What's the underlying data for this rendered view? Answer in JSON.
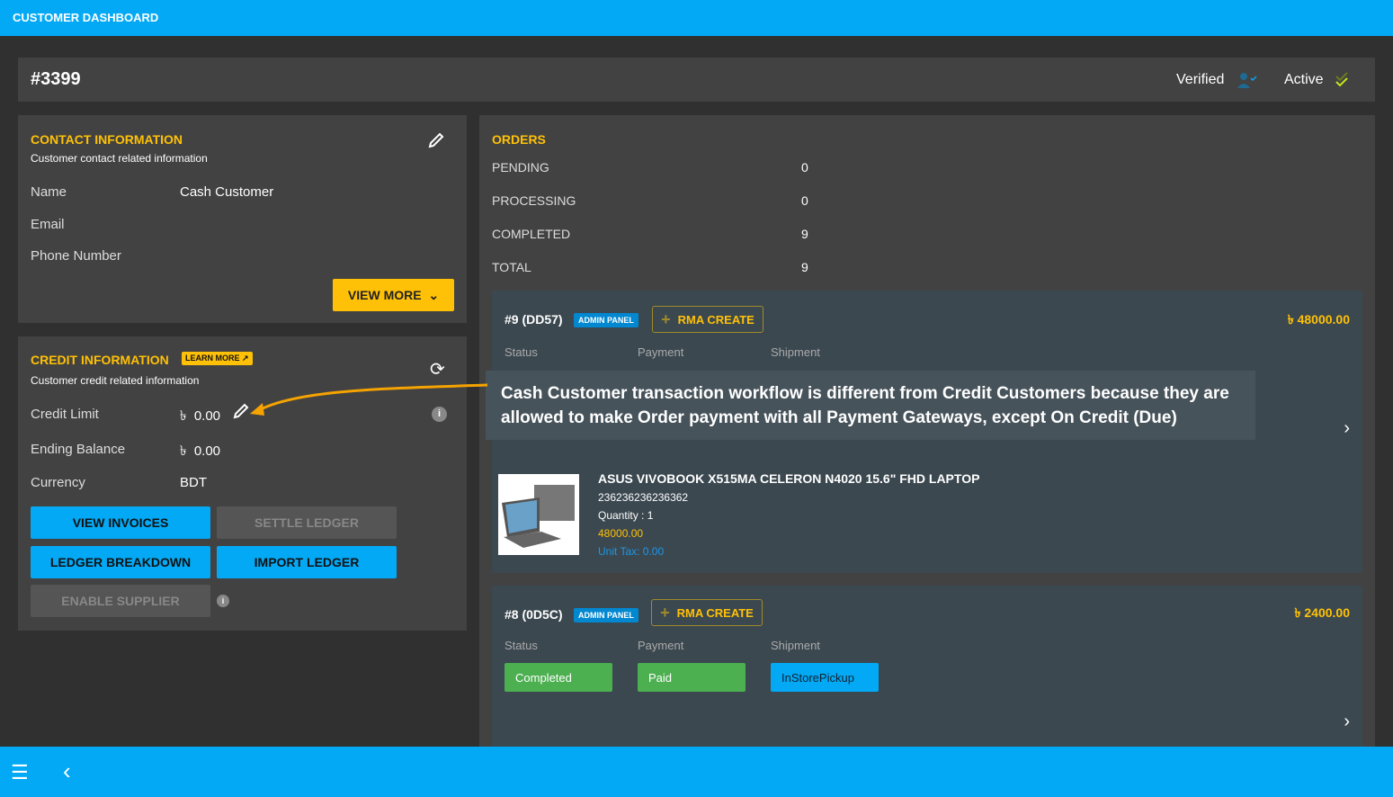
{
  "app_title": "CUSTOMER DASHBOARD",
  "customer": {
    "id": "#3399",
    "verified_label": "Verified",
    "active_label": "Active"
  },
  "contact": {
    "title": "CONTACT INFORMATION",
    "subtitle": "Customer contact related information",
    "fields": [
      {
        "label": "Name",
        "value": "Cash Customer"
      },
      {
        "label": "Email",
        "value": ""
      },
      {
        "label": "Phone Number",
        "value": ""
      }
    ],
    "view_more": "VIEW MORE"
  },
  "credit": {
    "title": "CREDIT INFORMATION",
    "learn_more": "LEARN MORE",
    "subtitle": "Customer credit related information",
    "currency_symbol": "৳",
    "fields": [
      {
        "label": "Credit Limit",
        "value": "0.00"
      },
      {
        "label": "Ending Balance",
        "value": "0.00"
      },
      {
        "label": "Currency",
        "value": "BDT"
      }
    ],
    "buttons": {
      "view_invoices": "VIEW INVOICES",
      "settle_ledger": "SETTLE LEDGER",
      "ledger_breakdown": "LEDGER BREAKDOWN",
      "import_ledger": "IMPORT LEDGER",
      "enable_supplier": "ENABLE SUPPLIER"
    }
  },
  "orders": {
    "title": "ORDERS",
    "summary": [
      {
        "label": "PENDING",
        "value": "0"
      },
      {
        "label": "PROCESSING",
        "value": "0"
      },
      {
        "label": "COMPLETED",
        "value": "9"
      },
      {
        "label": "TOTAL",
        "value": "9"
      }
    ],
    "col_labels": {
      "status": "Status",
      "payment": "Payment",
      "shipment": "Shipment"
    },
    "list": [
      {
        "id": "#9 (DD57)",
        "badge": "ADMIN PANEL",
        "rma": "RMA CREATE",
        "amount": "৳  48000.00",
        "item": {
          "name": "ASUS VIVOBOOK X515MA CELERON N4020 15.6\" FHD LAPTOP",
          "sku": "236236236236362",
          "quantity": "Quantity : 1",
          "price": "48000.00",
          "tax": "Unit Tax: 0.00"
        }
      },
      {
        "id": "#8 (0D5C)",
        "badge": "ADMIN PANEL",
        "rma": "RMA CREATE",
        "amount": "৳  2400.00",
        "status": "Completed",
        "payment": "Paid",
        "shipment": "InStorePickup"
      }
    ]
  },
  "annotation": "Cash Customer transaction workflow is different from Credit Customers because they are allowed to make Order payment with all Payment Gateways, except On Credit (Due)",
  "colors": {
    "primary": "#03a9f4",
    "accent": "#ffc107",
    "success": "#4caf50"
  }
}
